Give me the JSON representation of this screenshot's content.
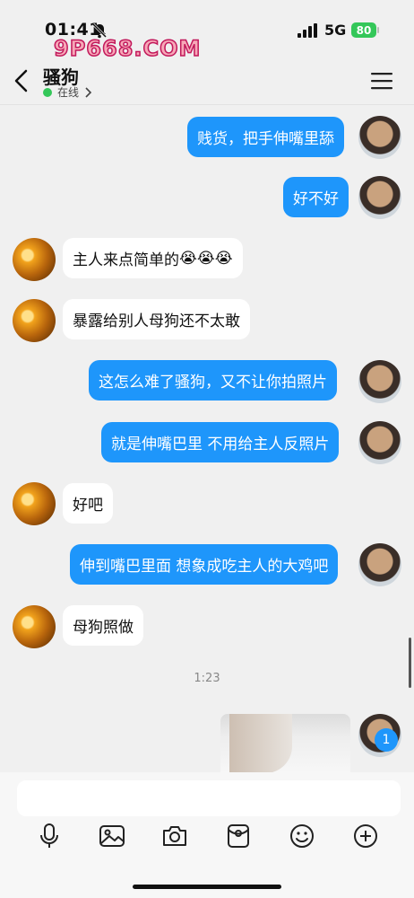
{
  "status_bar": {
    "time": "01:41",
    "watermark": "9P668.COM",
    "network": "5G",
    "battery": "80"
  },
  "nav": {
    "contact_name": "骚狗",
    "presence": "在线"
  },
  "messages": [
    {
      "text": "贱货，把手伸嘴里舔",
      "side": "out"
    },
    {
      "text": "好不好",
      "side": "out"
    },
    {
      "text": "主人来点简单的",
      "emoji": "😭😭😭",
      "side": "in"
    },
    {
      "text": "暴露给别人母狗还不太敢",
      "side": "in"
    },
    {
      "text": "这怎么难了骚狗，又不让你拍照片",
      "side": "out"
    },
    {
      "text": "就是伸嘴巴里 不用给主人反照片",
      "side": "out"
    },
    {
      "text": "好吧",
      "side": "in"
    },
    {
      "text": "伸到嘴巴里面 想象成吃主人的大鸡吧",
      "side": "out"
    },
    {
      "text": "母狗照做",
      "side": "in"
    }
  ],
  "timestamp": "1:23",
  "unread_count": "1",
  "input": {
    "placeholder": ""
  },
  "icons": [
    "back-icon",
    "menu-icon",
    "mic-icon",
    "image-icon",
    "camera-icon",
    "red-packet-icon",
    "emoji-icon",
    "plus-icon"
  ]
}
